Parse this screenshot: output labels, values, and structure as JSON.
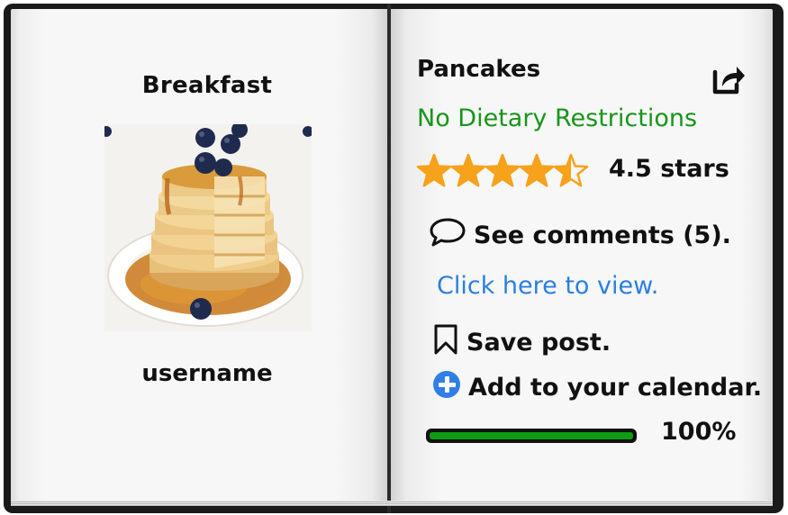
{
  "left_page": {
    "category": "Breakfast",
    "image_alt": "pancake-stack-with-blueberries",
    "username": "username"
  },
  "right_page": {
    "title": "Pancakes",
    "share_icon": "share-icon",
    "dietary": "No Dietary Restrictions",
    "rating": {
      "value": 4.5,
      "max": 5,
      "label": "4.5 stars"
    },
    "comments_label": "See comments (5).",
    "view_link": "Click here to view.",
    "save_label": "Save post.",
    "calendar_label": "Add to your calendar.",
    "progress": {
      "value": 100,
      "label": "100%"
    }
  },
  "colors": {
    "dietary": "#17951a",
    "link": "#2a7fe0",
    "star": "#f7a21b",
    "progress": "#0f9b12",
    "add_icon": "#2f7fe6"
  }
}
